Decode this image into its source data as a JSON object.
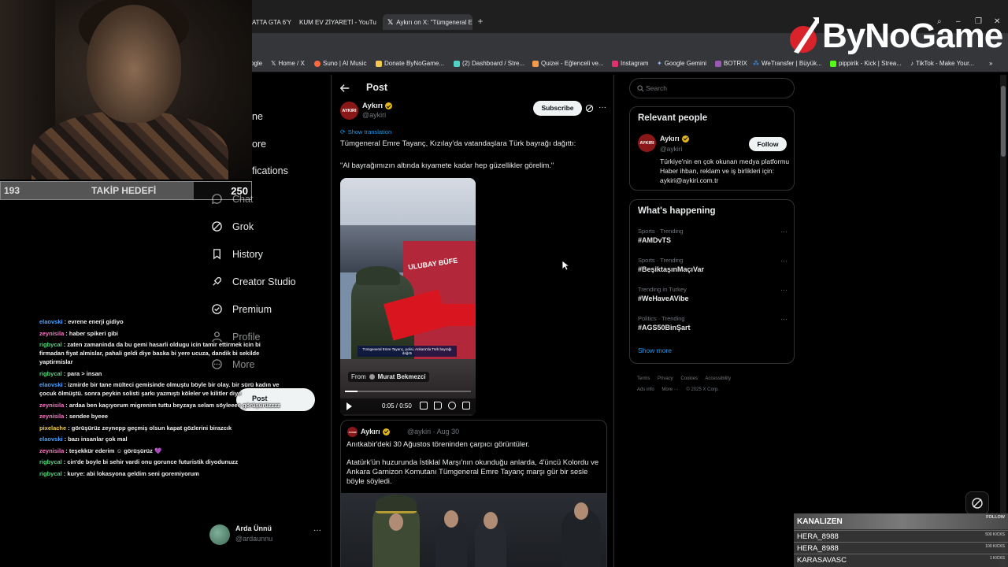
{
  "browser": {
    "tabs": [
      {
        "label": "ATTA GTA 6'Y",
        "icon_color": "#cfcfcf"
      },
      {
        "label": "KUM EV ZİYARETİ - YouTu",
        "icon_color": "#ff0000"
      },
      {
        "label": "Aykırı on X: \"Tümgeneral E",
        "icon_color": "#ffffff"
      }
    ],
    "new_tab_symbol": "+",
    "bookmarks": [
      {
        "label": "ogle",
        "icon_color": "#888888"
      },
      {
        "label": "Home / X",
        "icon_color": "#ffffff"
      },
      {
        "label": "Suno | AI Music",
        "icon_color": "#ff6a3d"
      },
      {
        "label": "Donate ByNoGame...",
        "icon_color": "#f2c94c"
      },
      {
        "label": "(2) Dashboard / Stre...",
        "icon_color": "#4fd1c5"
      },
      {
        "label": "Quizei - Eğlenceli ve...",
        "icon_color": "#f2994a"
      },
      {
        "label": "Instagram",
        "icon_color": "#e1306c"
      },
      {
        "label": "Google Gemini",
        "icon_color": "#8ab4f8"
      },
      {
        "label": "BOTRIX",
        "icon_color": "#9b59b6"
      },
      {
        "label": "WeTransfer | Büyük...",
        "icon_color": "#409fff"
      },
      {
        "label": "pippirik - Kick | Strea...",
        "icon_color": "#53fc18"
      },
      {
        "label": "TikTok - Make Your...",
        "icon_color": "#ffffff"
      }
    ],
    "bookmarks_more": "»"
  },
  "overlay": {
    "logo_text": "ByNoGame",
    "goal": {
      "current": "193",
      "label": "TAKİP HEDEFİ",
      "target": "250",
      "progress": 0.77
    }
  },
  "nav": {
    "partial_items": [
      {
        "label": "ne"
      },
      {
        "label": "ore"
      },
      {
        "label": "fications"
      },
      {
        "label": "Chat"
      }
    ],
    "items": [
      {
        "label": "Grok",
        "icon": "grok-icon"
      },
      {
        "label": "History",
        "icon": "bookmark-icon"
      },
      {
        "label": "Creator Studio",
        "icon": "rocket-icon"
      },
      {
        "label": "Premium",
        "icon": "verified-icon"
      },
      {
        "label": "Profile",
        "icon": "person-icon"
      },
      {
        "label": "More",
        "icon": "more-circle-icon"
      }
    ],
    "post_button": "Post",
    "account": {
      "name": "Arda Ünnü",
      "handle": "@ardaunnu",
      "more": "···"
    }
  },
  "chat": {
    "messages": [
      {
        "user": "elaovski",
        "color": "#4aa3ff",
        "text": ": evrene enerji gidiyo"
      },
      {
        "user": "zeynisila",
        "color": "#ff77c8",
        "text": ": haber spikeri gibi"
      },
      {
        "user": "rigbycal",
        "color": "#4ad97a",
        "text": ": zaten zamaninda da bu gemi hasarli oldugu icin tamir ettirmek icin bi firmadan fiyat almislar, pahali geldi diye baska bi yere ucuza, dandik bi sekilde yaptirmislar"
      },
      {
        "user": "rigbycal",
        "color": "#4ad97a",
        "text": ": para > insan"
      },
      {
        "user": "elaovski",
        "color": "#4aa3ff",
        "text": ": izmirde bir tane mülteci gemisinde olmuştu böyle bir olay. bir sürü kadın ve çocuk ölmüştü. sonra peykin solisti şarkı yazmıştı köleler ve kilitler diye"
      },
      {
        "user": "zeynisila",
        "color": "#ff77c8",
        "text": ": ardaa ben kaçıyorum migrenim tuttu beyzaya selam söyleeee görüşürüzzzz"
      },
      {
        "user": "zeynisila",
        "color": "#ff77c8",
        "text": ": sendee byeee"
      },
      {
        "user": "pixelache",
        "color": "#f2d04a",
        "text": ": görüşürüz zeynepp geçmiş olsun kapat gözlerini birazcık"
      },
      {
        "user": "elaovski",
        "color": "#4aa3ff",
        "text": ": bazı insanlar çok mal"
      },
      {
        "user": "zeynisila",
        "color": "#ff77c8",
        "text": ": teşekkür ederim ☺ görüşürüz 💜"
      },
      {
        "user": "rigbycal",
        "color": "#4ad97a",
        "text": ": cin'de boyle bi sehir vardi onu gorunce futuristik diyodunuzz"
      },
      {
        "user": "rigbycal",
        "color": "#4ad97a",
        "text": ": kurye: abi lokasyona geldim seni goremiyorum"
      }
    ]
  },
  "post": {
    "header_title": "Post",
    "author": {
      "name": "Aykırı",
      "handle": "@aykiri",
      "avatar_text": "AYKIRI"
    },
    "subscribe_label": "Subscribe",
    "show_translation": "Show translation",
    "text_line1": "Tümgeneral Emre Tayanç, Kızılay'da vatandaşlara Türk bayrağı dağıttı:",
    "text_line2": "\"Al bayrağımızın altında kıyamete kadar hep güzellikler görelim.\"",
    "video": {
      "booth_text": "ULUBAY BÜFE",
      "caption": "Tümgeneral Emre Tayanç, polisi, Ankara'da Türk bayrağı dağıttı",
      "from_label": "From",
      "from_name": "Murat Bekmezci",
      "time": "0:05 / 0:50",
      "progress": 0.1
    },
    "quote": {
      "author_name": "Aykırı",
      "meta": "@aykiri · Aug 30",
      "avatar_text": "AYKIRI",
      "text1": "Anıtkabir'deki 30 Ağustos töreninden çarpıcı görüntüler.",
      "text2": "Atatürk'ün huzurunda İstiklal Marşı'nın okunduğu anlarda, 4'üncü Kolordu ve Ankara Garnizon Komutanı Tümgeneral Emre Tayanç marşı gür bir sesle böyle söyledi."
    }
  },
  "sidebar": {
    "search_placeholder": "Search",
    "relevant": {
      "title": "Relevant people",
      "name": "Aykırı",
      "handle": "@aykiri",
      "avatar_text": "AYKIRI",
      "follow_label": "Follow",
      "bio": "Türkiye'nin en çok okunan medya platformu Haber ihban, reklam ve iş birlikleri için: aykiri@aykiri.com.tr"
    },
    "happening": {
      "title": "What's happening",
      "trends": [
        {
          "meta": "Sports · Trending",
          "tag": "#AMDvTS"
        },
        {
          "meta": "Sports · Trending",
          "tag": "#BeşiktaşınMaçıVar"
        },
        {
          "meta": "Trending in Turkey",
          "tag": "#WeHaveAVibe"
        },
        {
          "meta": "Politics · Trending",
          "tag": "#AGS50BinŞart"
        }
      ],
      "show_more": "Show more"
    },
    "footer": {
      "terms": "Terms",
      "privacy": "Privacy",
      "cookies": "Cookies",
      "accessibility": "Accessibility",
      "ads": "Ads info",
      "more": "More ···",
      "copyright": "© 2025 X Corp."
    }
  },
  "kick": {
    "title": "KANALIZEN",
    "follow": "FOLLOW",
    "rows": [
      {
        "name": "HERA_8988",
        "value": "500 KICKS"
      },
      {
        "name": "HERA_8988",
        "value": "100 KICKS"
      },
      {
        "name": "KARASAVASC",
        "value": "1 KICKS"
      }
    ]
  }
}
